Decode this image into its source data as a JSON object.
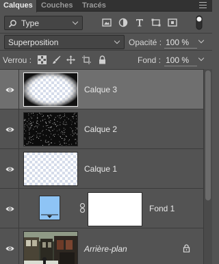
{
  "tabs": [
    {
      "label": "Calques",
      "active": true
    },
    {
      "label": "Couches",
      "active": false
    },
    {
      "label": "Tracés",
      "active": false
    }
  ],
  "filter": {
    "kind_label": "Type",
    "icons": [
      "image-filter-icon",
      "adjustment-filter-icon",
      "text-filter-icon",
      "shape-filter-icon",
      "smart-object-filter-icon",
      "filter-toggle-icon"
    ]
  },
  "blend": {
    "mode": "Superposition",
    "opacity_label": "Opacité :",
    "opacity_value": "100 %"
  },
  "lock": {
    "label": "Verrou :",
    "icons": [
      "lock-transparency-icon",
      "lock-pixels-icon",
      "lock-position-icon",
      "lock-artboard-icon",
      "lock-all-icon"
    ],
    "fill_label": "Fond :",
    "fill_value": "100 %"
  },
  "layers": [
    {
      "name": "Calque 3",
      "selected": true,
      "kind": "vignette"
    },
    {
      "name": "Calque 2",
      "selected": false,
      "kind": "noise"
    },
    {
      "name": "Calque 1",
      "selected": false,
      "kind": "transparent"
    },
    {
      "name": "Fond 1",
      "selected": false,
      "kind": "fill-with-mask"
    },
    {
      "name": "Arrière-plan",
      "selected": false,
      "kind": "background",
      "locked": true
    }
  ],
  "colors": {
    "panel_bg": "#535353",
    "selected_row": "#6f6f6f",
    "fill_swatch": "#8ec4f5"
  }
}
